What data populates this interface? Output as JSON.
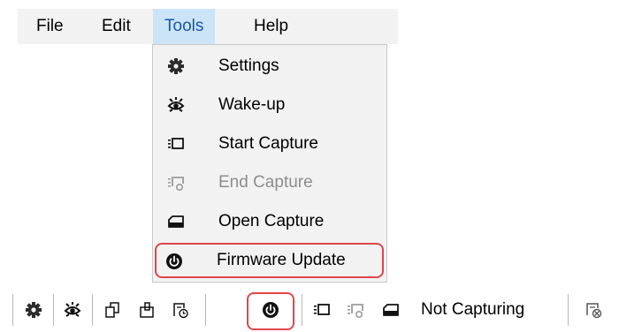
{
  "menubar": {
    "items": [
      {
        "label": "File"
      },
      {
        "label": "Edit"
      },
      {
        "label": "Tools"
      },
      {
        "label": "Help"
      }
    ],
    "active": "Tools"
  },
  "tools_menu": {
    "items": [
      {
        "label": "Settings",
        "icon": "gear-icon",
        "enabled": true
      },
      {
        "label": "Wake-up",
        "icon": "wake-eye-icon",
        "enabled": true
      },
      {
        "label": "Start Capture",
        "icon": "start-capture-icon",
        "enabled": true
      },
      {
        "label": "End Capture",
        "icon": "end-capture-icon",
        "enabled": false
      },
      {
        "label": "Open Capture",
        "icon": "folder-icon",
        "enabled": true
      },
      {
        "label": "Firmware Update",
        "icon": "power-icon",
        "enabled": true,
        "highlighted": true
      }
    ]
  },
  "toolbar": {
    "status": "Not Capturing",
    "icons": [
      "gear-icon",
      "wake-eye-icon",
      "export-icon",
      "import-icon",
      "schedule-icon",
      "power-icon",
      "start-capture-icon",
      "end-capture-icon",
      "folder-icon",
      "disconnect-icon"
    ]
  },
  "colors": {
    "menu_bg": "#f2f2f2",
    "active_menu_bg": "#cce4f7",
    "highlight_border": "#e0454b",
    "disabled_text": "#8d8d8d"
  }
}
